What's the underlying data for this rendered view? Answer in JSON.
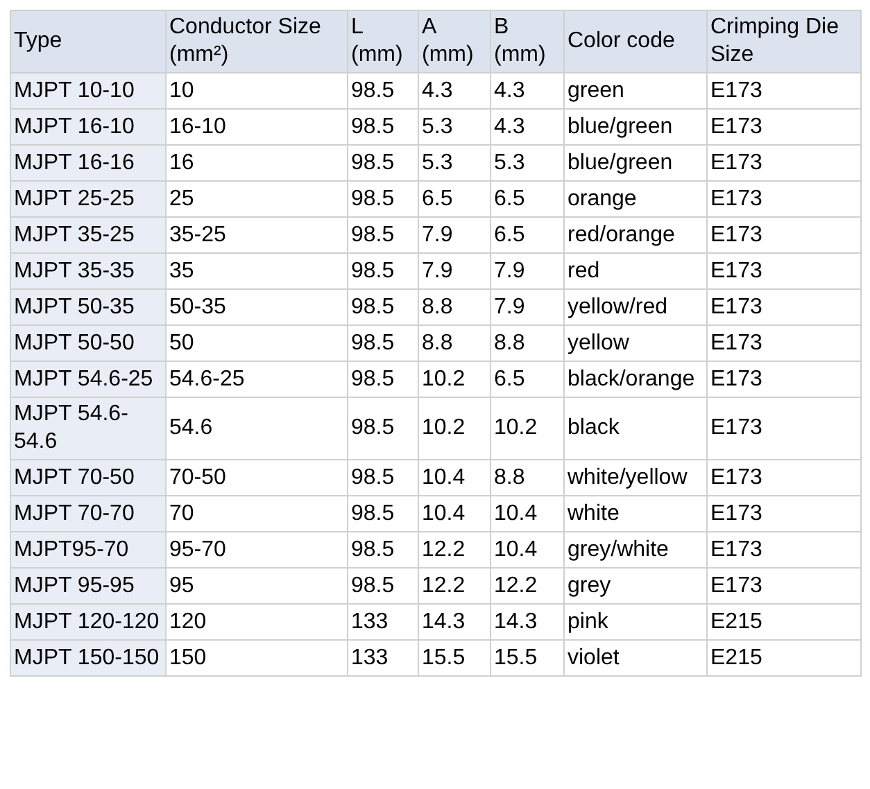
{
  "table": {
    "columns": [
      "Type",
      "Conductor Size (mm²)",
      "L (mm)",
      "A (mm)",
      "B (mm)",
      "Color code",
      "Crimping Die Size"
    ],
    "rows": [
      [
        "MJPT 10-10",
        "10",
        "98.5",
        "4.3",
        "4.3",
        "green",
        "E173"
      ],
      [
        "MJPT 16-10",
        "16-10",
        "98.5",
        "5.3",
        "4.3",
        "blue/green",
        "E173"
      ],
      [
        "MJPT 16-16",
        "16",
        "98.5",
        "5.3",
        "5.3",
        "blue/green",
        "E173"
      ],
      [
        "MJPT 25-25",
        "25",
        "98.5",
        "6.5",
        "6.5",
        "orange",
        "E173"
      ],
      [
        "MJPT 35-25",
        "35-25",
        "98.5",
        "7.9",
        "6.5",
        "red/orange",
        "E173"
      ],
      [
        "MJPT 35-35",
        "35",
        "98.5",
        "7.9",
        "7.9",
        "red",
        "E173"
      ],
      [
        "MJPT 50-35",
        "50-35",
        "98.5",
        "8.8",
        "7.9",
        "yellow/red",
        "E173"
      ],
      [
        "MJPT 50-50",
        "50",
        "98.5",
        "8.8",
        "8.8",
        "yellow",
        "E173"
      ],
      [
        "MJPT 54.6-25",
        "54.6-25",
        "98.5",
        "10.2",
        "6.5",
        "black/orange",
        "E173"
      ],
      [
        "MJPT 54.6-54.6",
        "54.6",
        "98.5",
        "10.2",
        "10.2",
        "black",
        "E173"
      ],
      [
        "MJPT 70-50",
        "70-50",
        "98.5",
        "10.4",
        "8.8",
        "white/yellow",
        "E173"
      ],
      [
        "MJPT 70-70",
        "70",
        "98.5",
        "10.4",
        "10.4",
        "white",
        "E173"
      ],
      [
        "MJPT95-70",
        "95-70",
        "98.5",
        "12.2",
        "10.4",
        "grey/white",
        "E173"
      ],
      [
        "MJPT 95-95",
        "95",
        "98.5",
        "12.2",
        "12.2",
        "grey",
        "E173"
      ],
      [
        "MJPT 120-120",
        "120",
        "133",
        "14.3",
        "14.3",
        "pink",
        "E215"
      ],
      [
        "MJPT 150-150",
        "150",
        "133",
        "15.5",
        "15.5",
        "violet",
        "E215"
      ]
    ]
  }
}
